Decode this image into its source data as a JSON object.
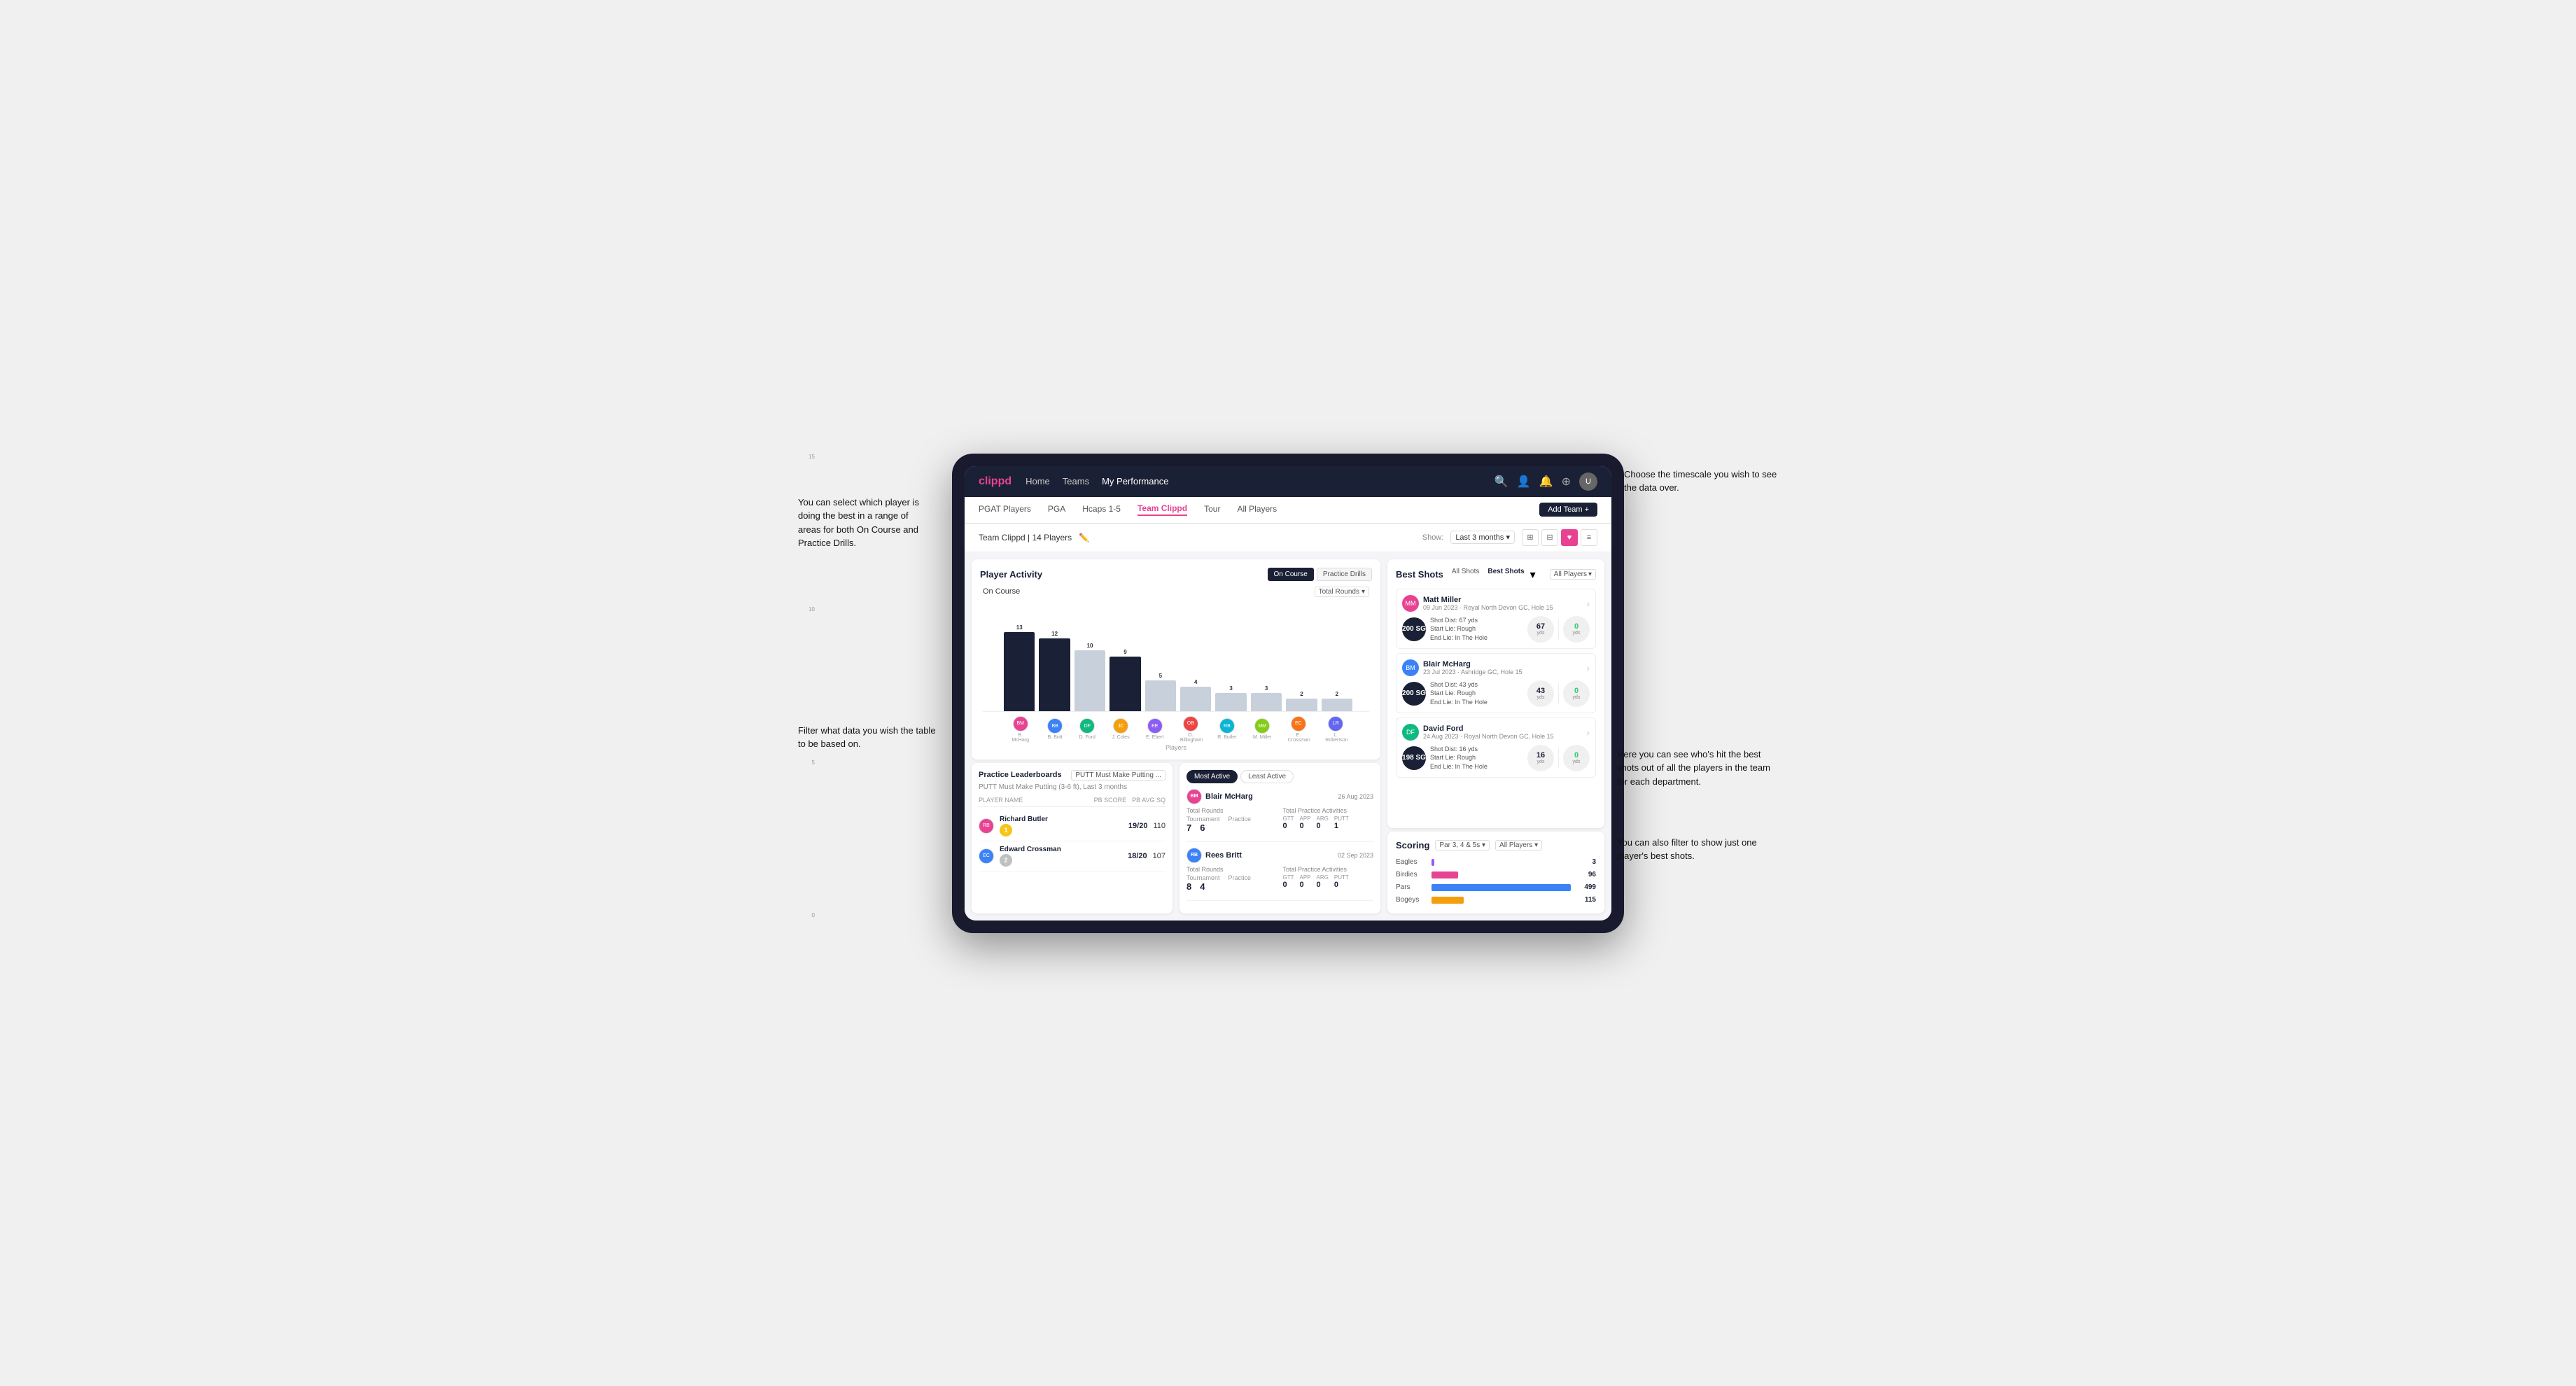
{
  "brand": "clippd",
  "nav": {
    "links": [
      "Home",
      "Teams",
      "My Performance"
    ],
    "active": "Teams",
    "icons": [
      "🔍",
      "👤",
      "🔔",
      "⊕"
    ]
  },
  "subnav": {
    "items": [
      "PGAT Players",
      "PGA",
      "Hcaps 1-5",
      "Team Clippd",
      "Tour",
      "All Players"
    ],
    "active": "Team Clippd",
    "add_team_label": "Add Team +"
  },
  "filter_bar": {
    "team_label": "Team Clippd | 14 Players",
    "show_label": "Show:",
    "time_filter": "Last 3 months",
    "view_options": [
      "⊞",
      "⊟",
      "♥",
      "≡"
    ]
  },
  "player_activity": {
    "title": "Player Activity",
    "toggle_options": [
      "On Course",
      "Practice Drills"
    ],
    "active_toggle": "On Course",
    "section_label": "On Course",
    "chart_filter": "Total Rounds",
    "x_axis_label": "Players",
    "y_ticks": [
      "15",
      "10",
      "5",
      "0"
    ],
    "bars": [
      {
        "label": "B. McHarg",
        "value": 13,
        "highlight": true
      },
      {
        "label": "B. Britt",
        "value": 12,
        "highlight": true
      },
      {
        "label": "D. Ford",
        "value": 10,
        "highlight": false
      },
      {
        "label": "J. Coles",
        "value": 9,
        "highlight": true
      },
      {
        "label": "E. Ebert",
        "value": 5,
        "highlight": false
      },
      {
        "label": "O. Billingham",
        "value": 4,
        "highlight": false
      },
      {
        "label": "R. Butler",
        "value": 3,
        "highlight": false
      },
      {
        "label": "M. Miller",
        "value": 3,
        "highlight": false
      },
      {
        "label": "E. Crossman",
        "value": 2,
        "highlight": false
      },
      {
        "label": "L. Robertson",
        "value": 2,
        "highlight": false
      }
    ],
    "max_value": 15
  },
  "practice_leaderboards": {
    "title": "Practice Leaderboards",
    "filter": "PUTT Must Make Putting ...",
    "subtitle": "PUTT Must Make Putting (3-6 ft), Last 3 months",
    "columns": [
      "PLAYER NAME",
      "PB SCORE",
      "PB AVG SQ"
    ],
    "players": [
      {
        "rank": 1,
        "name": "Richard Butler",
        "rank_num": "1",
        "pb_score": "19/20",
        "pb_avg": "110"
      },
      {
        "rank": 2,
        "name": "Edward Crossman",
        "rank_num": "2",
        "pb_score": "18/20",
        "pb_avg": "107"
      }
    ]
  },
  "most_active": {
    "title": "Most Active",
    "tabs": [
      "Most Active",
      "Least Active"
    ],
    "active_tab": "Most Active",
    "players": [
      {
        "name": "Blair McHarg",
        "date": "26 Aug 2023",
        "total_rounds_label": "Total Rounds",
        "tournament_val": "7",
        "practice_val": "6",
        "total_practice_label": "Total Practice Activities",
        "gtt_val": "0",
        "app_val": "0",
        "arg_val": "0",
        "putt_val": "1"
      },
      {
        "name": "Rees Britt",
        "date": "02 Sep 2023",
        "total_rounds_label": "Total Rounds",
        "tournament_val": "8",
        "practice_val": "4",
        "total_practice_label": "Total Practice Activities",
        "gtt_val": "0",
        "app_val": "0",
        "arg_val": "0",
        "putt_val": "0"
      }
    ]
  },
  "best_shots": {
    "title": "Best Shots",
    "tabs": [
      "All Shots",
      "Best Shots"
    ],
    "active_tab": "All Shots",
    "players_filter": "All Players",
    "shots": [
      {
        "player_name": "Matt Miller",
        "player_date": "09 Jun 2023 · Royal North Devon GC, Hole 15",
        "badge_text": "200 SG",
        "shot_dist": "67 yds",
        "start_lie": "Rough",
        "end_lie": "In The Hole",
        "dist_val": "67",
        "dist_unit": "yds",
        "end_val": "0",
        "end_unit": "yds"
      },
      {
        "player_name": "Blair McHarg",
        "player_date": "23 Jul 2023 · Ashridge GC, Hole 15",
        "badge_text": "200 SG",
        "shot_dist": "43 yds",
        "start_lie": "Rough",
        "end_lie": "In The Hole",
        "dist_val": "43",
        "dist_unit": "yds",
        "end_val": "0",
        "end_unit": "yds"
      },
      {
        "player_name": "David Ford",
        "player_date": "24 Aug 2023 · Royal North Devon GC, Hole 15",
        "badge_text": "198 SG",
        "shot_dist": "16 yds",
        "start_lie": "Rough",
        "end_lie": "In The Hole",
        "dist_val": "16",
        "dist_unit": "yds",
        "end_val": "0",
        "end_unit": "yds"
      }
    ]
  },
  "scoring": {
    "title": "Scoring",
    "filter1": "Par 3, 4 & 5s",
    "filter2": "All Players",
    "rows": [
      {
        "label": "Eagles",
        "value": 3,
        "max": 500,
        "color": "eagles"
      },
      {
        "label": "Birdies",
        "value": 96,
        "max": 500,
        "color": "birdies"
      },
      {
        "label": "Pars",
        "value": 499,
        "max": 500,
        "color": "pars"
      },
      {
        "label": "Bogeys",
        "value": 115,
        "max": 500,
        "color": "bogeys"
      }
    ]
  },
  "annotations": {
    "top_left": "You can select which player is\ndoing the best in a range of\nareas for both On Course and\nPractice Drills.",
    "top_right": "Choose the timescale you\nwish to see the data over.",
    "bottom_left": "Filter what data you wish the\ntable to be based on.",
    "mid_right": "Here you can see who's hit\nthe best shots out of all the\nplayers in the team for\neach department.",
    "bottom_right": "You can also filter to show\njust one player's best shots."
  }
}
